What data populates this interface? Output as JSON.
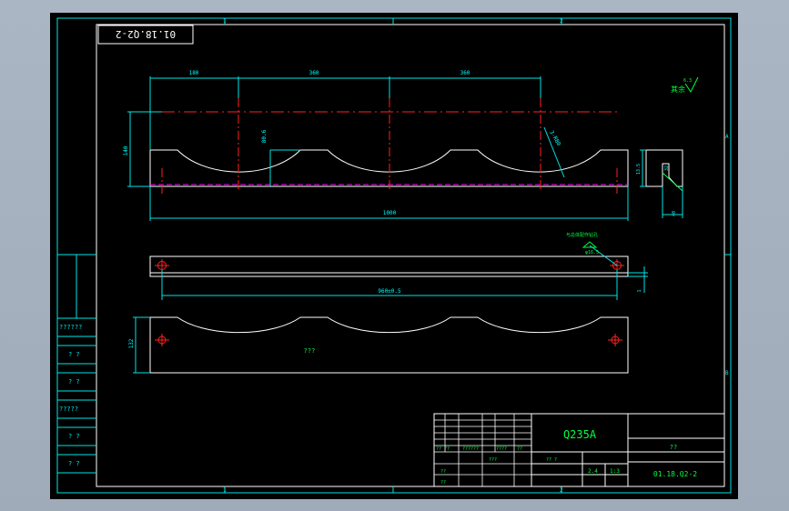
{
  "colors": {
    "background": "#aab6c4",
    "paper": "#000000",
    "frame": "#ffffff",
    "grid": "#00ffff",
    "centerline": "#ff2020",
    "dimension": "#00ffff",
    "annotation": "#00ff40",
    "hidden": "#ff00ff"
  },
  "drawing": {
    "title_stamp": "01.18.Q2-2",
    "zone_top": [
      "1",
      "2"
    ],
    "zone_bottom": [
      "1",
      "2"
    ],
    "zone_right": [
      "A",
      "B"
    ],
    "roughness_note": "其余",
    "roughness_value": "6.3"
  },
  "dimensions": {
    "spacing_1": "180",
    "spacing_2": "360",
    "spacing_3": "360",
    "height_left": "140",
    "depth": "80.6",
    "radius": "3-R80",
    "overall_length": "1000",
    "section_width": "32",
    "section_depth": "20",
    "section_side": "13.5",
    "section_bottom": "40",
    "hole_note": "与总体配作钻孔",
    "hole_size": "φ16.5",
    "hole_spacing": "960±0.5",
    "thickness": "1",
    "bottom_view_height": "132",
    "center_note": "???"
  },
  "title_block": {
    "material": "Q235A",
    "part_name": "??",
    "drawing_no": "01.18.Q2-2",
    "scale_label": "?? ?",
    "sheets_label": "2.4",
    "scale_value": "1:3",
    "row_labels": [
      "?? ??",
      "??????",
      "????",
      "??"
    ],
    "sign_labels": [
      "??",
      "??",
      "???"
    ]
  },
  "left_column": {
    "labels": [
      "??????",
      "? ?",
      "? ?",
      "?????",
      "? ?",
      "? ?"
    ]
  }
}
